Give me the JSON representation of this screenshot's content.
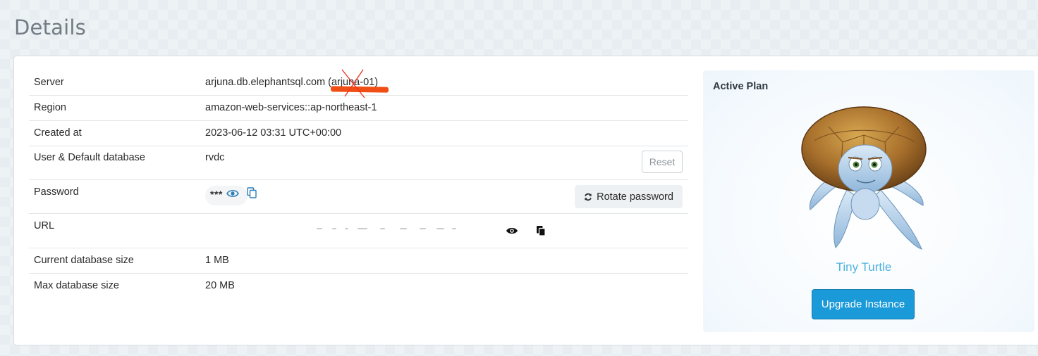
{
  "page": {
    "title": "Details"
  },
  "details": {
    "server": {
      "label": "Server",
      "value": "arjuna.db.elephantsql.com (arjuna-01)"
    },
    "region": {
      "label": "Region",
      "value": "amazon-web-services::ap-northeast-1"
    },
    "created": {
      "label": "Created at",
      "value": "2023-06-12 03:31 UTC+00:00"
    },
    "user": {
      "label": "User & Default database",
      "value": "rvdc",
      "reset_label": "Reset"
    },
    "password": {
      "label": "Password",
      "masked": "***",
      "rotate_label": "Rotate password"
    },
    "url": {
      "label": "URL"
    },
    "current_size": {
      "label": "Current database size",
      "value": "1 MB"
    },
    "max_size": {
      "label": "Max database size",
      "value": "20 MB"
    }
  },
  "plan": {
    "heading": "Active Plan",
    "name": "Tiny Turtle",
    "upgrade_label": "Upgrade Instance"
  },
  "icons": {
    "show": "eye-icon",
    "copy": "copy-icon",
    "rotate": "refresh-icon",
    "plan_mascot": "turtle-illustration"
  },
  "colors": {
    "accent": "#1a9ad9",
    "plan_name": "#4fb2e0",
    "annotation": "#f04e14"
  }
}
